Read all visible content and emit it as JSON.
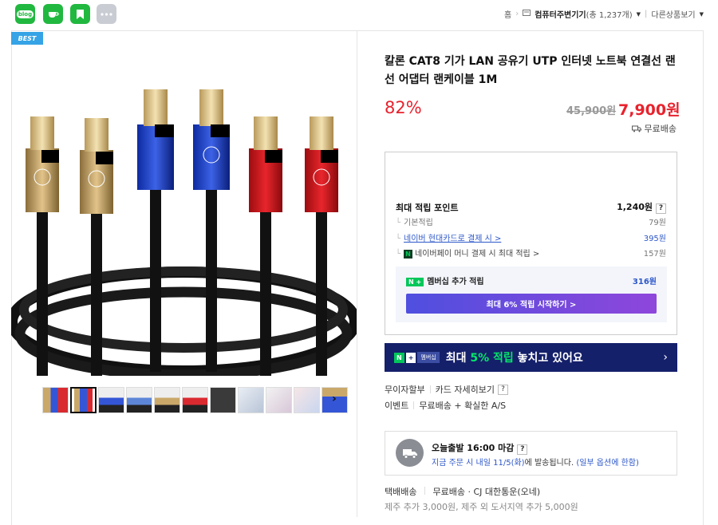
{
  "share": {
    "icons": [
      "blog-icon",
      "cafe-icon",
      "bookmark-icon",
      "more-icon"
    ],
    "blog_label": "blog"
  },
  "breadcrumb": {
    "home": "홈",
    "category": "컴퓨터주변기기",
    "count": "(총 1,237개)",
    "other": "다른상품보기"
  },
  "badge": "BEST",
  "product": {
    "title": "칼론 CAT8 기가 LAN 공유기 UTP 인터넷 노트북 연결선 랜선 어댑터 랜케이블 1M",
    "discount": "82%",
    "original_price": "45,900원",
    "sale_price": "7,900원",
    "free_shipping": "무료배송"
  },
  "points": {
    "max_label": "최대 적립 포인트",
    "max_value": "1,240원",
    "basic_label": "기본적립",
    "basic_value": "79원",
    "card_label": "네이버 현대카드로 결제 시 >",
    "card_value": "395원",
    "npay_label": "네이버페이 머니 결제 시 최대 적립 >",
    "npay_value": "157원",
    "member_label": "멤버십 추가 적립",
    "member_value": "316원",
    "member_button": "최대 6% 적립 시작하기 >"
  },
  "banner": {
    "n_tag": "N",
    "plus_tag": "+",
    "membership_tag": "멤버십",
    "text_pre": "최대 ",
    "text_highlight": "5% 적립",
    "text_post": " 놓치고 있어요"
  },
  "info": {
    "installment": "무이자할부",
    "card_detail": "카드 자세히보기",
    "event": "이벤트",
    "event_detail": "무료배송 + 확실한 A/S"
  },
  "shipping": {
    "today": "오늘출발 16:00 마감",
    "order_now": "지금 주문 시 내일 11/5(화)",
    "order_post": "에 발송됩니다.",
    "note": "(일부 옵션에 한함)",
    "method_label": "택배배송",
    "method_value": "무료배송 · CJ 대한통운(오네)",
    "extra": "제주 추가 3,000원, 제주 외 도서지역 추가 5,000원"
  },
  "colors": {
    "accent_red": "#e8222d",
    "naver_green": "#03c75a",
    "link_blue": "#2d57c9",
    "banner_navy": "#15206a"
  }
}
